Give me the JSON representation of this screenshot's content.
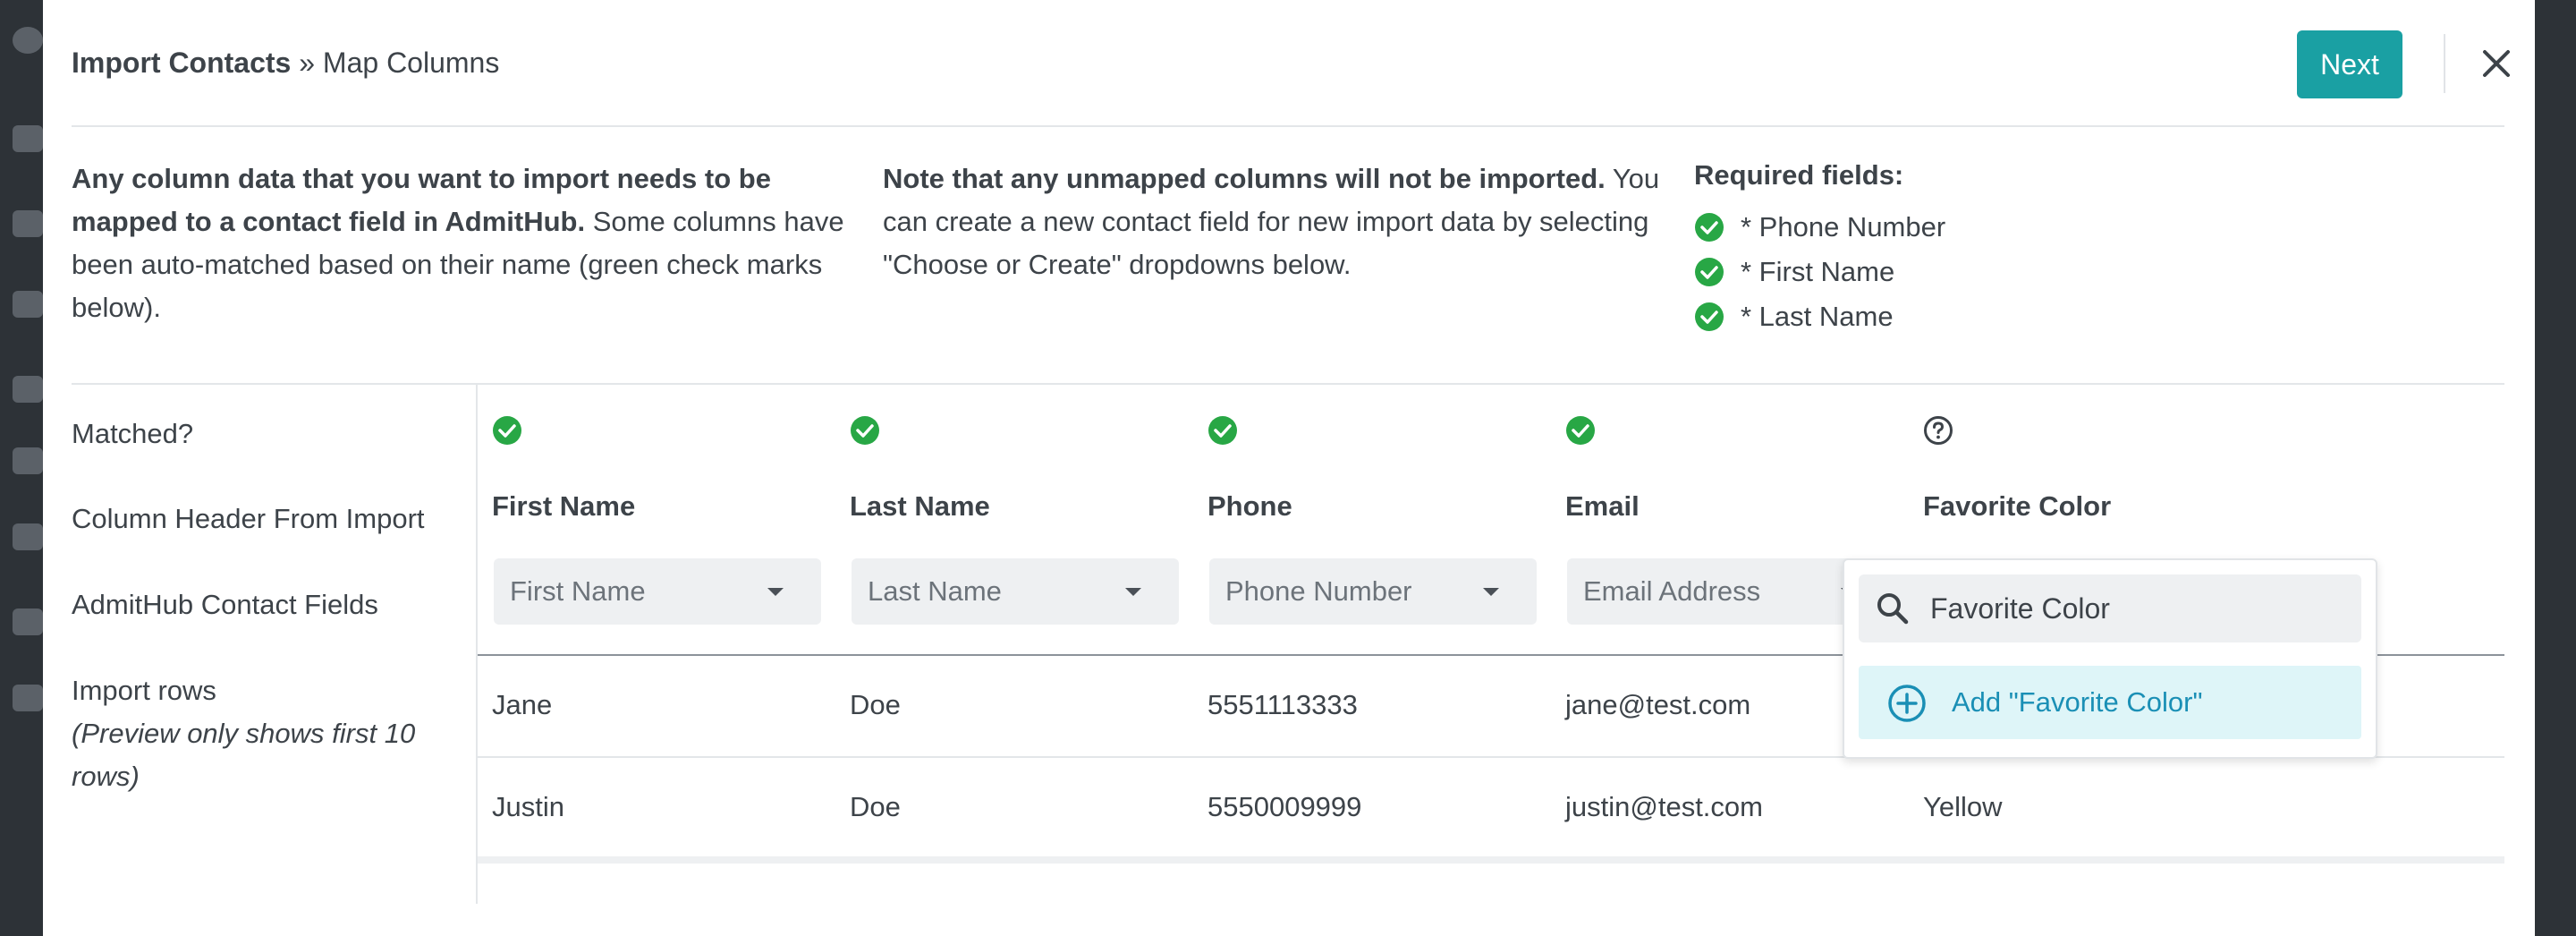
{
  "header": {
    "title_bold": "Import Contacts",
    "title_rest": " » Map Columns",
    "next_label": "Next"
  },
  "info": {
    "col1_bold": "Any column data that you want to import needs to be mapped to a contact field in AdmitHub.",
    "col1_text": " Some columns have been auto-matched based on their name (green check marks below).",
    "col2_bold": "Note that any unmapped columns will not be imported.",
    "col2_text": " You can create a new contact field for new import data by selecting \"Choose or Create\" dropdowns below.",
    "required_title": "Required fields:",
    "required": [
      "* Phone Number",
      "* First Name",
      "* Last Name"
    ]
  },
  "labels": {
    "matched": "Matched?",
    "column_header": "Column Header From Import",
    "contact_fields": "AdmitHub Contact Fields",
    "import_rows": "Import rows",
    "import_rows_note": "(Preview only shows first 10 rows)"
  },
  "columns": [
    {
      "header": "First Name",
      "field": "First Name",
      "matched": true
    },
    {
      "header": "Last Name",
      "field": "Last Name",
      "matched": true
    },
    {
      "header": "Phone",
      "field": "Phone Number",
      "matched": true
    },
    {
      "header": "Email",
      "field": "Email Address",
      "matched": true
    },
    {
      "header": "Favorite Color",
      "field": "",
      "matched": false
    }
  ],
  "rows": [
    [
      "Jane",
      "Doe",
      "5551113333",
      "jane@test.com",
      ""
    ],
    [
      "Justin",
      "Doe",
      "5550009999",
      "justin@test.com",
      "Yellow"
    ]
  ],
  "dropdown": {
    "search_value": "Favorite Color",
    "add_label": "Add \"Favorite Color\""
  },
  "colors": {
    "accent": "#1aa0a3",
    "check_green": "#28a745",
    "link_blue": "#1a8fb5",
    "option_highlight": "#def5f8"
  }
}
